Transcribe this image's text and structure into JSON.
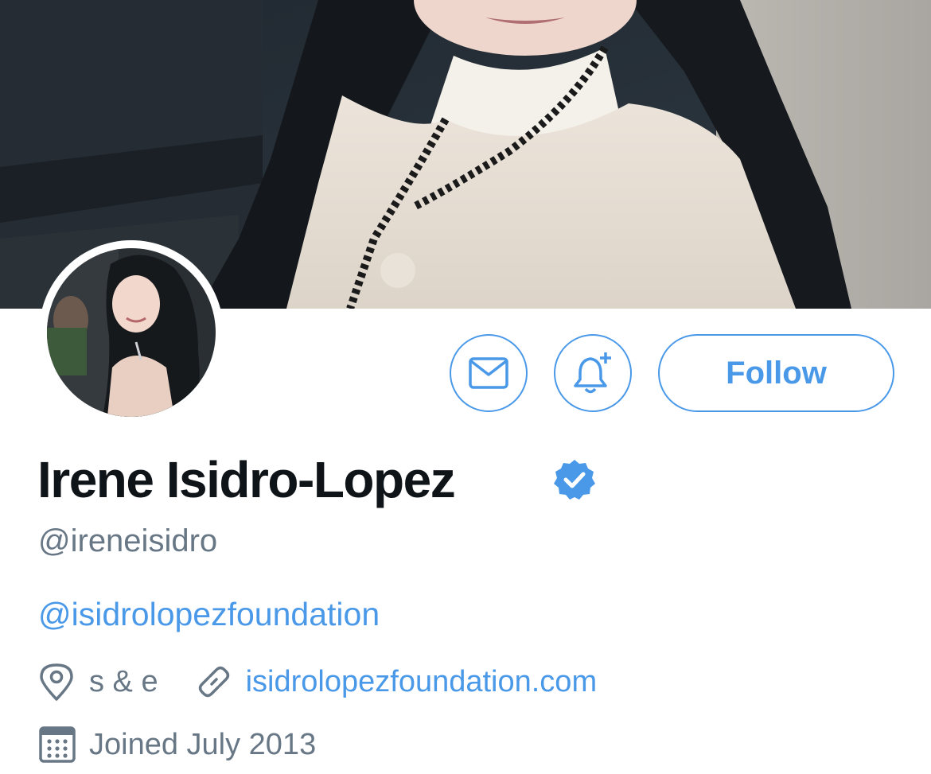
{
  "profile": {
    "display_name": "Irene Isidro-Lopez",
    "handle": "@ireneisidro",
    "bio_mention": "@isidrolopezfoundation",
    "location": "s & e",
    "website": "isidrolopezfoundation.com",
    "joined": "Joined July 2013",
    "verified": true
  },
  "actions": {
    "message_icon": "mail-icon",
    "notify_icon": "bell-plus-icon",
    "follow_label": "Follow"
  },
  "icons": {
    "location": "location-pin-icon",
    "website": "link-icon",
    "joined": "calendar-icon",
    "verified": "verified-badge-icon"
  },
  "colors": {
    "accent": "#4a99e9",
    "secondary_text": "#687785",
    "primary_text": "#0f1419"
  }
}
